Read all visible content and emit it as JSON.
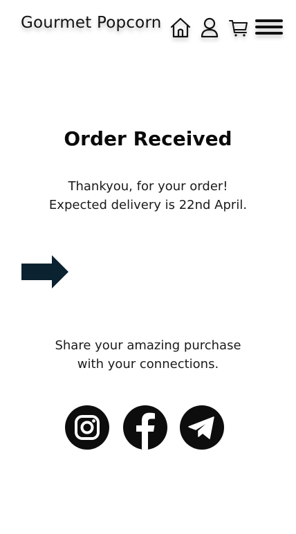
{
  "header": {
    "brand": "Gourmet Popcorn",
    "icons": [
      "home-icon",
      "user-icon",
      "cart-icon",
      "menu-icon"
    ]
  },
  "main": {
    "title": "Order Received",
    "message_line1": "Thankyou, for your order!",
    "message_line2": "Expected delivery is 22nd April.",
    "share_line1": "Share your amazing purchase",
    "share_line2": "with your connections."
  },
  "social": [
    "instagram-icon",
    "facebook-icon",
    "telegram-icon"
  ],
  "colors": {
    "text": "#111111",
    "icon_dark": "#0d0d0d",
    "arrow": "#0b2230"
  }
}
